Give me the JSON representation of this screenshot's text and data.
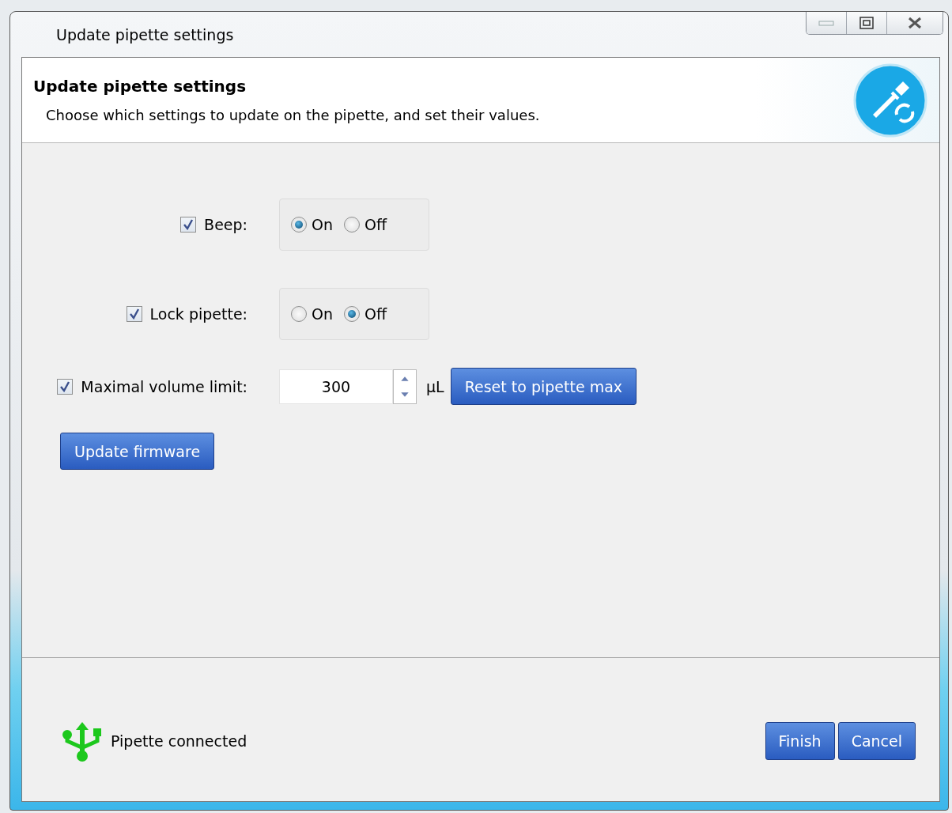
{
  "window": {
    "title": "Update pipette settings"
  },
  "header": {
    "title": "Update pipette settings",
    "description": "Choose which settings to update on the pipette, and set their values."
  },
  "settings": [
    {
      "kind": "toggle",
      "label": "Beep:",
      "checked": true,
      "options": [
        {
          "label": "On",
          "selected": true
        },
        {
          "label": "Off",
          "selected": false
        }
      ]
    },
    {
      "kind": "toggle",
      "label": "Lock pipette:",
      "checked": true,
      "options": [
        {
          "label": "On",
          "selected": false
        },
        {
          "label": "Off",
          "selected": true
        }
      ]
    },
    {
      "kind": "number",
      "label": "Maximal volume limit:",
      "checked": true,
      "value": "300",
      "unit": "µL",
      "button": "Reset to pipette max"
    }
  ],
  "firmware_button": "Update firmware",
  "status": {
    "text": "Pipette connected"
  },
  "buttons": [
    "Finish",
    "Cancel"
  ]
}
